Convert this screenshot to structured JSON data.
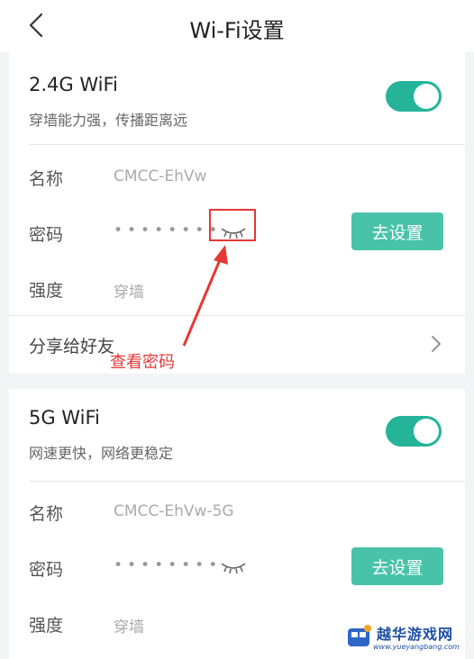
{
  "nav": {
    "title": "Wi-Fi设置"
  },
  "wifi24": {
    "title": "2.4G WiFi",
    "subtitle": "穿墙能力强，传播距离远",
    "name_label": "名称",
    "name_value": "CMCC-EhVw",
    "password_label": "密码",
    "password_masked": "••••••••",
    "set_button": "去设置",
    "strength_label": "强度",
    "strength_value": "穿墙",
    "share_label": "分享给好友"
  },
  "wifi5": {
    "title": "5G WiFi",
    "subtitle": "网速更快，网络更稳定",
    "name_label": "名称",
    "name_value": "CMCC-EhVw-5G",
    "password_label": "密码",
    "password_masked": "••••••••",
    "set_button": "去设置",
    "strength_label": "强度",
    "strength_value": "穿墙"
  },
  "annotation": {
    "text": "查看密码"
  },
  "watermark": {
    "name": "越华游戏网",
    "url": "www.yueyangbang.com"
  },
  "colors": {
    "accent": "#25b49a",
    "button": "#48c3aa",
    "annotation": "#e53935"
  },
  "icons": [
    "back-chevron-icon",
    "eye-closed-icon",
    "chevron-right-icon"
  ]
}
